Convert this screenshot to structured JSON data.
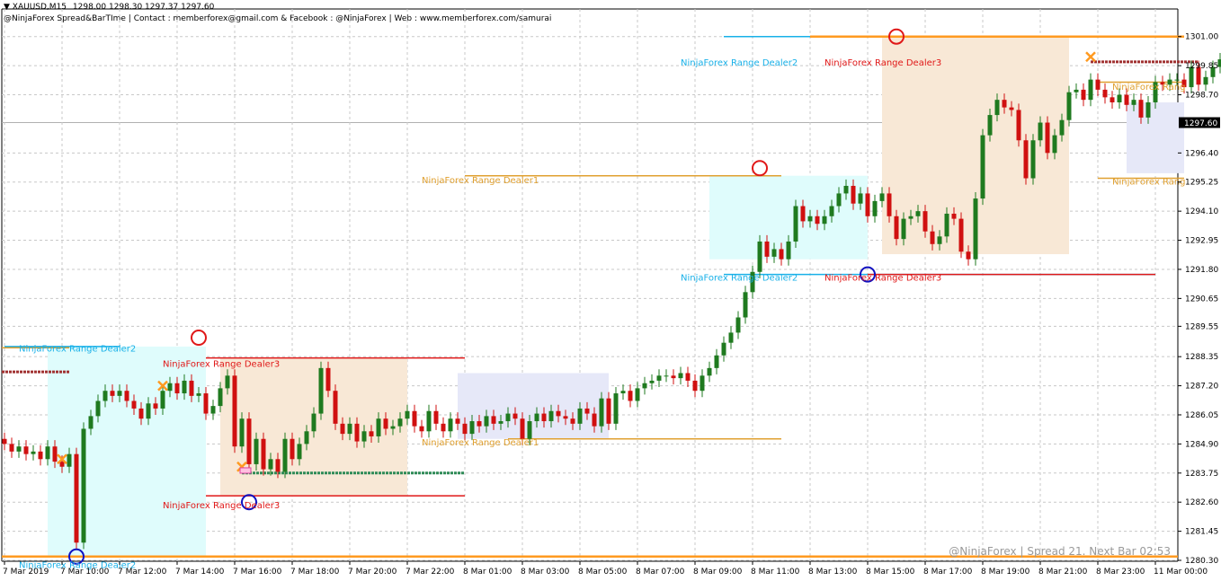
{
  "header": {
    "symbol": "XAUUSD,M15",
    "ohlc": "1298.00 1298.30 1297.37 1297.60",
    "info": "@NinjaForex Spread&BarTIme | Contact : memberforex@gmail.com & Facebook : @NinjaForex | Web : www.memberforex.com/samurai"
  },
  "footer": "@NinjaForex | Spread 21. Next Bar 02:53",
  "colors": {
    "bull": "#1f7a1f",
    "bear": "#d01010",
    "grid": "#c8c8c8",
    "cyan_zone": "#dffcfc",
    "peach_zone": "#f8e8d6",
    "lavender_zone": "#e6e8f8",
    "dealer1": "#e0a030",
    "dealer2": "#18b0e8",
    "dealer3": "#e01818",
    "orange": "#ff9a20"
  },
  "chart_data": {
    "type": "candlestick",
    "symbol": "XAUUSD",
    "timeframe": "M15",
    "ylim": [
      1280.3,
      1301.7
    ],
    "current_price": 1297.6,
    "y_ticks": [
      1301.0,
      1299.85,
      1298.7,
      1297.6,
      1296.4,
      1295.25,
      1294.1,
      1292.95,
      1291.8,
      1290.65,
      1289.55,
      1288.35,
      1287.2,
      1286.05,
      1284.9,
      1283.75,
      1282.6,
      1281.45,
      1280.3
    ],
    "x_labels": [
      "7 Mar 2019",
      "7 Mar 10:00",
      "7 Mar 12:00",
      "7 Mar 14:00",
      "7 Mar 16:00",
      "7 Mar 18:00",
      "7 Mar 20:00",
      "7 Mar 22:00",
      "8 Mar 01:00",
      "8 Mar 03:00",
      "8 Mar 05:00",
      "8 Mar 07:00",
      "8 Mar 09:00",
      "8 Mar 11:00",
      "8 Mar 13:00",
      "8 Mar 15:00",
      "8 Mar 17:00",
      "8 Mar 19:00",
      "8 Mar 21:00",
      "8 Mar 23:00",
      "11 Mar 00:00"
    ],
    "candles_per_label": 8,
    "closes": [
      1284.9,
      1284.6,
      1284.8,
      1284.5,
      1284.6,
      1284.3,
      1284.8,
      1284.2,
      1284.0,
      1284.5,
      1281.0,
      1285.5,
      1286.0,
      1286.6,
      1287.0,
      1286.8,
      1287.0,
      1286.6,
      1286.3,
      1285.9,
      1286.5,
      1286.3,
      1287.0,
      1287.3,
      1286.9,
      1287.4,
      1286.8,
      1286.9,
      1286.1,
      1286.4,
      1287.1,
      1287.6,
      1284.8,
      1285.9,
      1284.1,
      1285.1,
      1283.9,
      1284.3,
      1283.8,
      1285.1,
      1284.3,
      1284.9,
      1285.4,
      1286.1,
      1287.9,
      1287.0,
      1285.7,
      1285.3,
      1285.7,
      1285.0,
      1285.4,
      1285.2,
      1285.9,
      1285.5,
      1285.6,
      1285.9,
      1286.2,
      1285.6,
      1285.4,
      1286.2,
      1285.7,
      1285.4,
      1285.9,
      1285.7,
      1285.3,
      1285.8,
      1285.6,
      1286.0,
      1285.7,
      1285.8,
      1286.1,
      1285.9,
      1285.1,
      1285.8,
      1286.1,
      1285.8,
      1286.2,
      1286.0,
      1285.9,
      1285.7,
      1286.3,
      1286.1,
      1285.6,
      1286.7,
      1285.7,
      1286.9,
      1287.0,
      1286.6,
      1287.1,
      1287.3,
      1287.4,
      1287.6,
      1287.6,
      1287.5,
      1287.7,
      1287.4,
      1287.0,
      1287.6,
      1287.9,
      1288.4,
      1288.9,
      1289.3,
      1289.9,
      1290.9,
      1291.7,
      1292.9,
      1292.3,
      1292.6,
      1292.2,
      1292.9,
      1294.3,
      1293.7,
      1293.9,
      1293.6,
      1293.9,
      1294.3,
      1294.8,
      1295.1,
      1294.4,
      1294.8,
      1293.9,
      1294.5,
      1294.8,
      1293.9,
      1293.0,
      1293.8,
      1293.9,
      1294.1,
      1293.3,
      1292.8,
      1293.1,
      1294.0,
      1293.8,
      1292.5,
      1292.2,
      1294.6,
      1297.1,
      1297.9,
      1298.5,
      1298.2,
      1298.1,
      1296.9,
      1295.4,
      1296.9,
      1297.6,
      1296.4,
      1297.1,
      1297.7,
      1298.8,
      1298.9,
      1298.5,
      1299.3,
      1298.9,
      1298.6,
      1298.4,
      1298.7,
      1298.3,
      1298.5,
      1297.8,
      1298.4,
      1299.2,
      1299.1,
      1299.3,
      1299.3,
      1299.0,
      1299.8,
      1299.1,
      1299.4,
      1299.8,
      1300.1,
      1300.5,
      1299.9,
      1299.3,
      1298.8,
      1298.3,
      1297.7,
      1297.4,
      1296.8,
      1296.5,
      1296.7,
      1297.2,
      1297.4,
      1297.2,
      1297.3,
      1297.6
    ],
    "levels": [
      {
        "label": "NinjaForex Range Dealer2",
        "price": 1288.75,
        "color": "dealer2"
      },
      {
        "label": "NinjaForex Range Dealer2",
        "price": 1280.45,
        "color": "dealer2"
      },
      {
        "label": "NinjaForex Range Dealer3",
        "price": 1288.3,
        "color": "dealer3"
      },
      {
        "label": "NinjaForex Range Dealer3",
        "price": 1282.85,
        "color": "dealer3"
      },
      {
        "label": "NinjaForex Range Dealer1",
        "price": 1295.5,
        "color": "dealer1"
      },
      {
        "label": "NinjaForex Range Dealer1",
        "price": 1285.1,
        "color": "dealer1"
      },
      {
        "label": "NinjaForex Range Dealer2",
        "price": 1301.0,
        "color": "dealer2"
      },
      {
        "label": "NinjaForex Range Dealer2",
        "price": 1291.6,
        "color": "dealer2"
      },
      {
        "label": "NinjaForex Range Dealer3",
        "price": 1301.0,
        "color": "dealer3"
      },
      {
        "label": "NinjaForex Range Dealer3",
        "price": 1291.6,
        "color": "dealer3"
      },
      {
        "label": "NinjaForex Rang",
        "price": 1299.2,
        "color": "dealer1"
      },
      {
        "label": "NinjaForex Rang",
        "price": 1295.4,
        "color": "dealer1"
      }
    ]
  }
}
